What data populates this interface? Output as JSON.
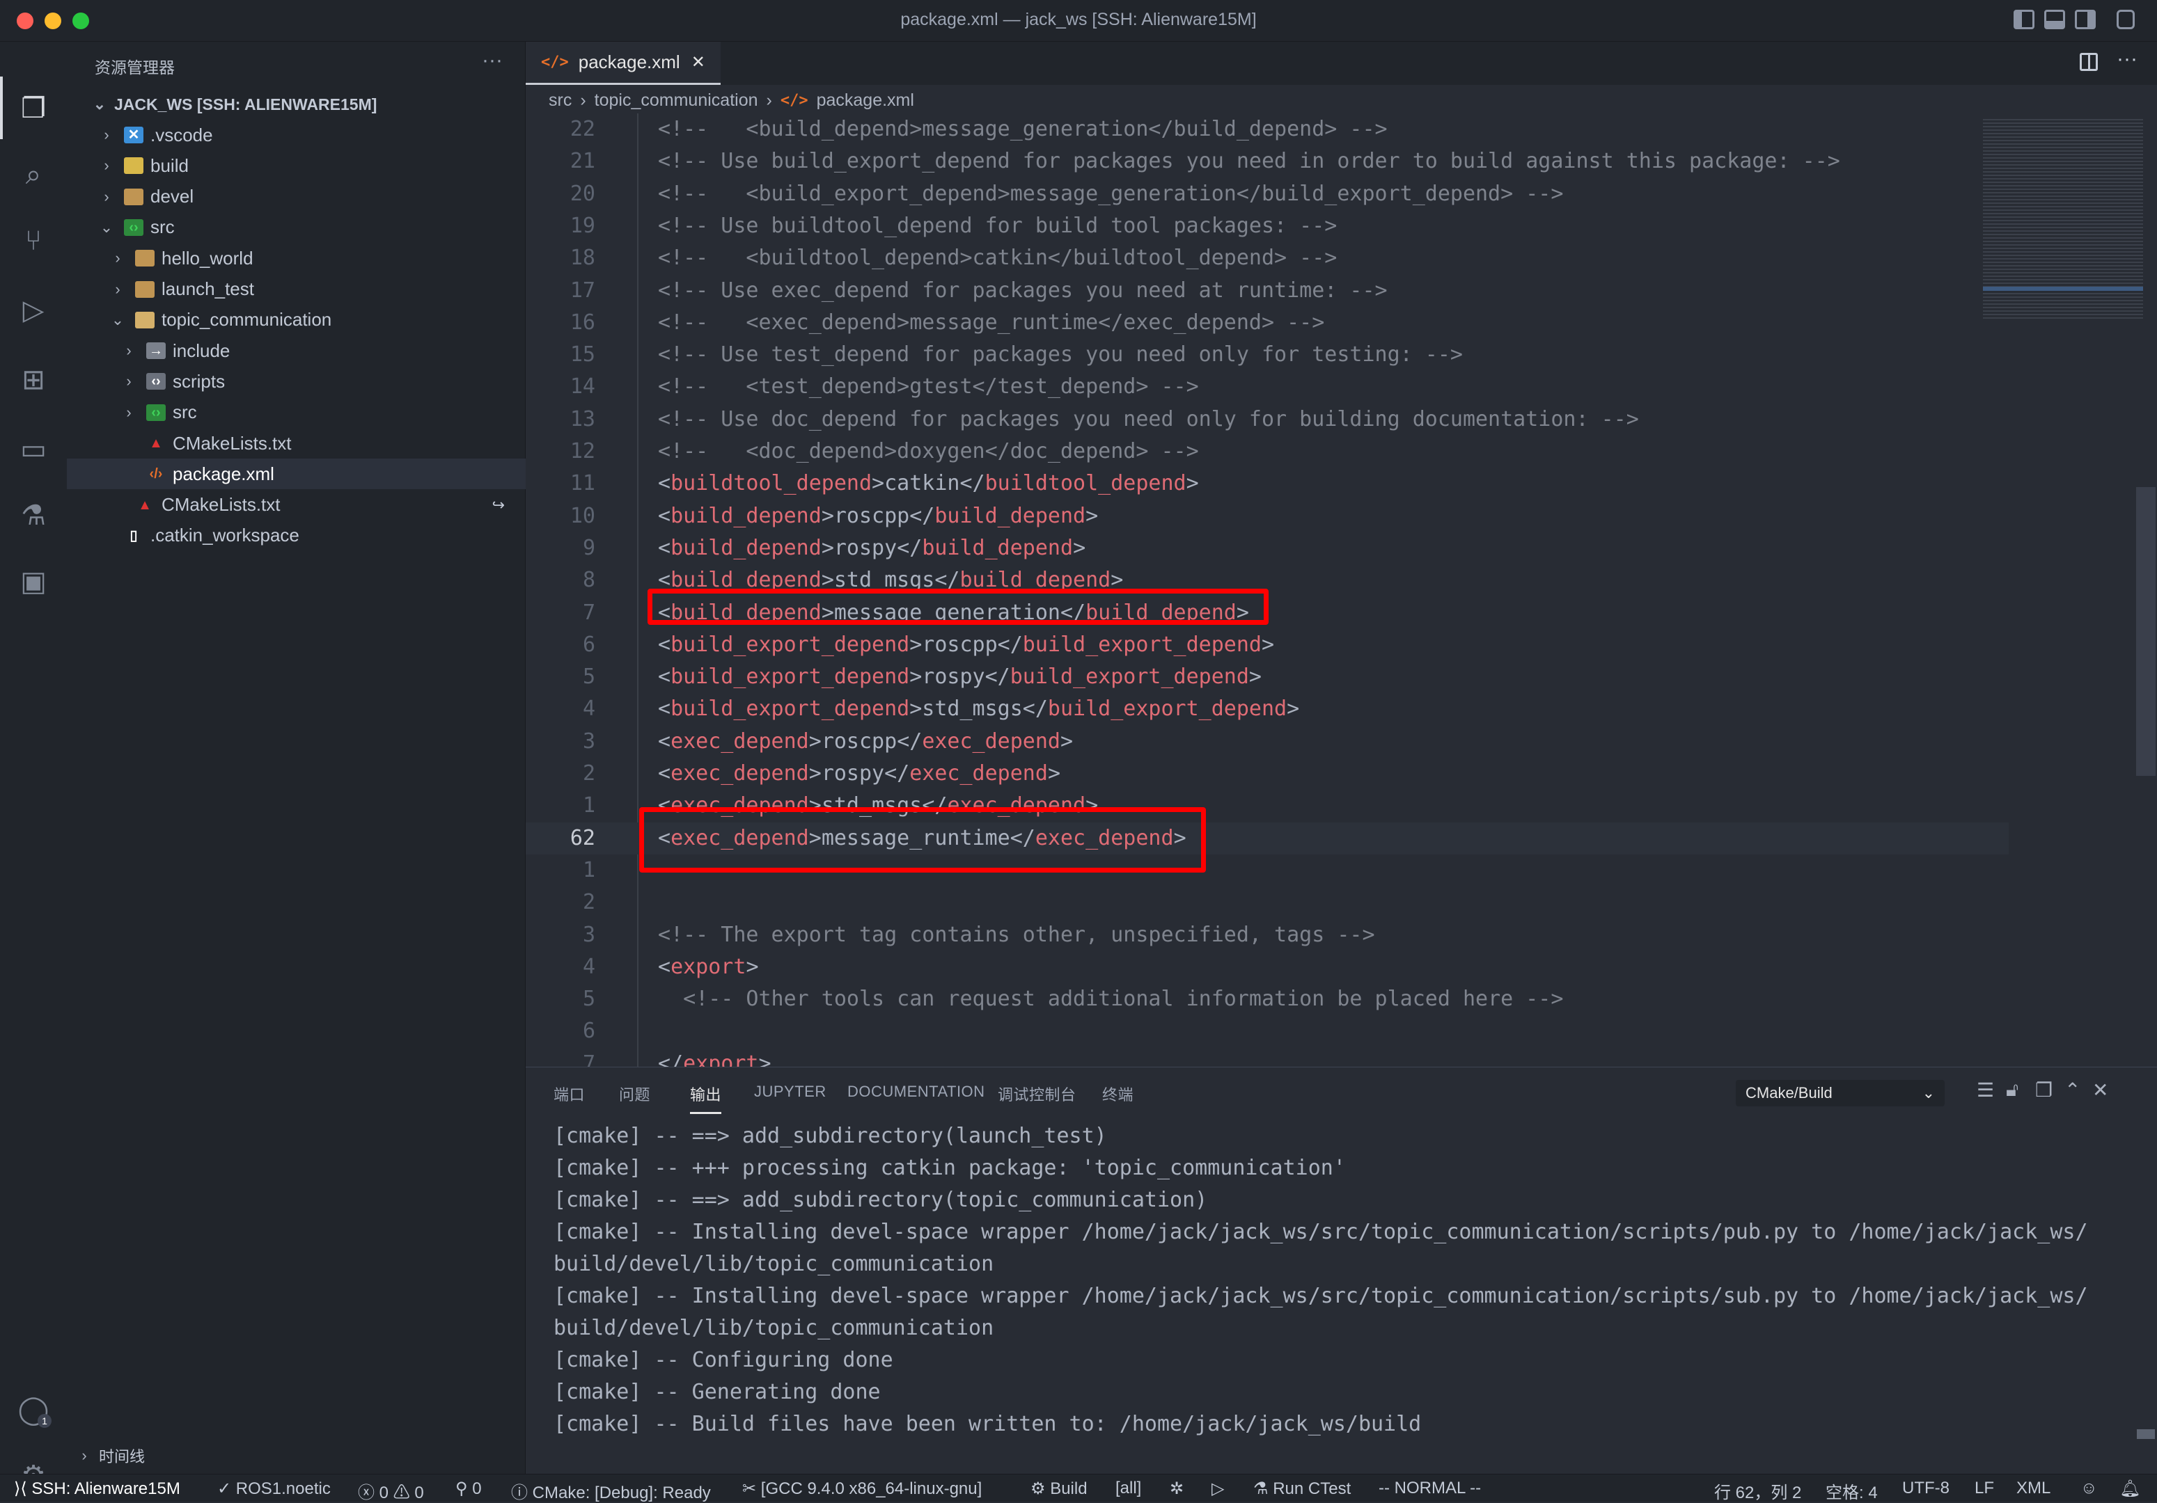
{
  "window": {
    "title": "package.xml — jack_ws [SSH: Alienware15M]"
  },
  "colors": {
    "background": "#282c34",
    "sidebar": "#21252b",
    "tag": "#e06c75",
    "comment": "#7f848e",
    "text": "#abb2bf",
    "highlight_box": "#ff0000",
    "xml_icon": "#e8702a"
  },
  "sidebar": {
    "title": "资源管理器",
    "root": "JACK_WS [SSH: ALIENWARE15M]",
    "timeline": "时间线",
    "items": [
      {
        "label": ".vscode",
        "icon": "vscode-folder-icon",
        "level": 1,
        "chevron": "right"
      },
      {
        "label": "build",
        "icon": "build-folder-icon",
        "level": 1,
        "chevron": "right"
      },
      {
        "label": "devel",
        "icon": "folder-icon",
        "level": 1,
        "chevron": "right"
      },
      {
        "label": "src",
        "icon": "src-folder-icon",
        "level": 1,
        "chevron": "down"
      },
      {
        "label": "hello_world",
        "icon": "folder-icon",
        "level": 2,
        "chevron": "right"
      },
      {
        "label": "launch_test",
        "icon": "folder-icon",
        "level": 2,
        "chevron": "right"
      },
      {
        "label": "topic_communication",
        "icon": "folder-open-icon",
        "level": 2,
        "chevron": "down"
      },
      {
        "label": "include",
        "icon": "include-folder-icon",
        "level": 3,
        "chevron": "right"
      },
      {
        "label": "scripts",
        "icon": "scripts-folder-icon",
        "level": 3,
        "chevron": "right"
      },
      {
        "label": "src",
        "icon": "src-folder-icon",
        "level": 3,
        "chevron": "right"
      },
      {
        "label": "CMakeLists.txt",
        "icon": "cmake-icon",
        "level": 3,
        "chevron": null
      },
      {
        "label": "package.xml",
        "icon": "xml-icon",
        "level": 3,
        "chevron": null,
        "selected": true
      },
      {
        "label": "CMakeLists.txt",
        "icon": "cmake-icon",
        "level": 2,
        "chevron": null,
        "symlink": true
      },
      {
        "label": ".catkin_workspace",
        "icon": "file-icon",
        "level": 1,
        "chevron": null
      }
    ]
  },
  "editor": {
    "tab": "package.xml",
    "breadcrumb": [
      "src",
      "topic_communication",
      "package.xml"
    ],
    "lines": [
      {
        "n": "22",
        "t": "<!--   <build_depend>message_generation</build_depend> -->"
      },
      {
        "n": "21",
        "t": "<!-- Use build_export_depend for packages you need in order to build against this package: -->"
      },
      {
        "n": "20",
        "t": "<!--   <build_export_depend>message_generation</build_export_depend> -->"
      },
      {
        "n": "19",
        "t": "<!-- Use buildtool_depend for build tool packages: -->"
      },
      {
        "n": "18",
        "t": "<!--   <buildtool_depend>catkin</buildtool_depend> -->"
      },
      {
        "n": "17",
        "t": "<!-- Use exec_depend for packages you need at runtime: -->"
      },
      {
        "n": "16",
        "t": "<!--   <exec_depend>message_runtime</exec_depend> -->"
      },
      {
        "n": "15",
        "t": "<!-- Use test_depend for packages you need only for testing: -->"
      },
      {
        "n": "14",
        "t": "<!--   <test_depend>gtest</test_depend> -->"
      },
      {
        "n": "13",
        "t": "<!-- Use doc_depend for packages you need only for building documentation: -->"
      },
      {
        "n": "12",
        "t": "<!--   <doc_depend>doxygen</doc_depend> -->"
      },
      {
        "n": "11",
        "t": "<buildtool_depend>catkin</buildtool_depend>"
      },
      {
        "n": "10",
        "t": "<build_depend>roscpp</build_depend>"
      },
      {
        "n": "9",
        "t": "<build_depend>rospy</build_depend>"
      },
      {
        "n": "8",
        "t": "<build_depend>std_msgs</build_depend>"
      },
      {
        "n": "7",
        "t": "<build_depend>message_generation</build_depend>"
      },
      {
        "n": "6",
        "t": "<build_export_depend>roscpp</build_export_depend>"
      },
      {
        "n": "5",
        "t": "<build_export_depend>rospy</build_export_depend>"
      },
      {
        "n": "4",
        "t": "<build_export_depend>std_msgs</build_export_depend>"
      },
      {
        "n": "3",
        "t": "<exec_depend>roscpp</exec_depend>"
      },
      {
        "n": "2",
        "t": "<exec_depend>rospy</exec_depend>"
      },
      {
        "n": "1",
        "t": "<exec_depend>std_msgs</exec_depend>"
      },
      {
        "n": "62",
        "t": "<exec_depend>message_runtime</exec_depend>",
        "current": true
      },
      {
        "n": "1",
        "t": ""
      },
      {
        "n": "2",
        "t": ""
      },
      {
        "n": "3",
        "t": "<!-- The export tag contains other, unspecified, tags -->"
      },
      {
        "n": "4",
        "t": "<export>"
      },
      {
        "n": "5",
        "t": "  <!-- Other tools can request additional information be placed here -->"
      },
      {
        "n": "6",
        "t": ""
      },
      {
        "n": "7",
        "t": "</export>"
      }
    ]
  },
  "panel": {
    "tabs": [
      "端口",
      "问题",
      "输出",
      "JUPYTER",
      "DOCUMENTATION",
      "调试控制台",
      "终端"
    ],
    "active_tab": "输出",
    "channel": "CMake/Build",
    "output": [
      "[cmake] -- ==> add_subdirectory(launch_test)",
      "[cmake] -- +++ processing catkin package: 'topic_communication'",
      "[cmake] -- ==> add_subdirectory(topic_communication)",
      "[cmake] -- Installing devel-space wrapper /home/jack/jack_ws/src/topic_communication/scripts/pub.py to /home/jack/jack_ws/",
      "build/devel/lib/topic_communication",
      "[cmake] -- Installing devel-space wrapper /home/jack/jack_ws/src/topic_communication/scripts/sub.py to /home/jack/jack_ws/",
      "build/devel/lib/topic_communication",
      "[cmake] -- Configuring done",
      "[cmake] -- Generating done",
      "[cmake] -- Build files have been written to: /home/jack/jack_ws/build"
    ]
  },
  "status": {
    "remote": "SSH: Alienware15M",
    "ros": "ROS1.noetic",
    "errors": "0",
    "warnings": "0",
    "ports": "0",
    "cmake": "CMake: [Debug]: Ready",
    "kit": "[GCC 9.4.0 x86_64-linux-gnu]",
    "build": "Build",
    "target": "[all]",
    "ctest": "Run CTest",
    "vim_mode": "-- NORMAL --",
    "position": "行 62，列 2",
    "indent": "空格: 4",
    "encoding": "UTF-8",
    "eol": "LF",
    "language": "XML",
    "account_badge": "1"
  }
}
